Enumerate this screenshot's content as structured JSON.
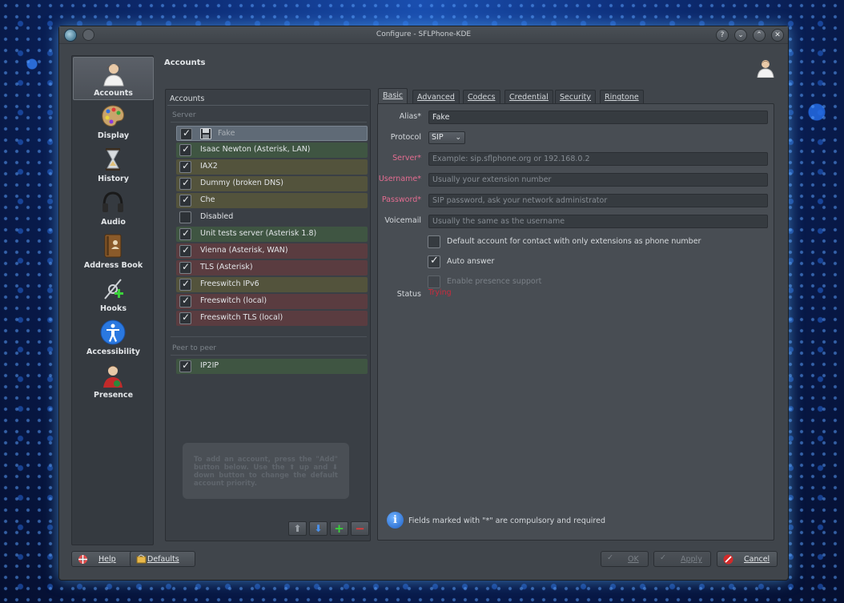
{
  "window": {
    "title": "Configure - SFLPhone-KDE"
  },
  "sidebar": {
    "items": [
      {
        "label": "Accounts",
        "icon": "accounts-person-icon",
        "selected": true
      },
      {
        "label": "Display",
        "icon": "palette-icon"
      },
      {
        "label": "History",
        "icon": "hourglass-icon"
      },
      {
        "label": "Audio",
        "icon": "headphones-icon"
      },
      {
        "label": "Address Book",
        "icon": "address-book-icon"
      },
      {
        "label": "Hooks",
        "icon": "hooks-plug-icon"
      },
      {
        "label": "Accessibility",
        "icon": "accessibility-icon"
      },
      {
        "label": "Presence",
        "icon": "presence-person-icon"
      }
    ]
  },
  "page": {
    "title": "Accounts"
  },
  "accounts": {
    "header": "Accounts",
    "server_label": "Server",
    "server": [
      {
        "name": "Fake",
        "checked": true,
        "color": "sel"
      },
      {
        "name": "Isaac Newton (Asterisk, LAN)",
        "checked": true,
        "color": "green"
      },
      {
        "name": "IAX2",
        "checked": true,
        "color": "olive"
      },
      {
        "name": "Dummy (broken DNS)",
        "checked": true,
        "color": "olive"
      },
      {
        "name": "Che",
        "checked": true,
        "color": "olive"
      },
      {
        "name": "Disabled",
        "checked": false,
        "color": "none"
      },
      {
        "name": "Unit tests server (Asterisk 1.8)",
        "checked": true,
        "color": "green"
      },
      {
        "name": "Vienna (Asterisk, WAN)",
        "checked": true,
        "color": "red"
      },
      {
        "name": "TLS (Asterisk)",
        "checked": true,
        "color": "red"
      },
      {
        "name": "Freeswitch IPv6",
        "checked": true,
        "color": "olive"
      },
      {
        "name": "Freeswitch (local)",
        "checked": true,
        "color": "red"
      },
      {
        "name": "Freeswitch TLS (local)",
        "checked": true,
        "color": "red"
      }
    ],
    "p2p_label": "Peer to peer",
    "p2p": [
      {
        "name": "IP2IP",
        "checked": true,
        "color": "green"
      }
    ],
    "hint": "To add an account, press the \"Add\" button below. Use the ⬆ up and ⬇ down button to change the default account priority."
  },
  "tabs": [
    "Basic",
    "Advanced",
    "Codecs",
    "Credential",
    "Security",
    "Ringtone"
  ],
  "form": {
    "alias_label": "Alias*",
    "alias_value": "Fake",
    "protocol_label": "Protocol",
    "protocol_value": "SIP",
    "server_label": "Server*",
    "server_placeholder": "Example: sip.sflphone.org or 192.168.0.2",
    "username_label": "Username*",
    "username_placeholder": "Usually your extension number",
    "password_label": "Password*",
    "password_placeholder": "SIP password, ask your network administrator",
    "voicemail_label": "Voicemail",
    "voicemail_placeholder": "Usually the same as the username",
    "default_account_label": "Default account for contact with only extensions as phone number",
    "auto_answer_label": "Auto answer",
    "presence_label": "Enable presence support",
    "status_label": "Status",
    "status_value": "Trying",
    "info": "Fields marked with \"*\" are compulsory and required"
  },
  "buttons": {
    "help": "Help",
    "defaults": "Defaults",
    "ok": "OK",
    "apply": "Apply",
    "cancel": "Cancel"
  },
  "colors": {
    "green_row": "#3f5542",
    "olive_row": "#53533c",
    "red_row": "#5a3c40",
    "required_label": "#e46d91",
    "status_error": "#cc2a3c"
  }
}
